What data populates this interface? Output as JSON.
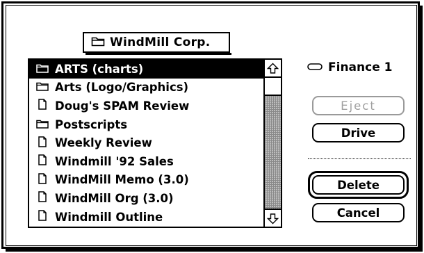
{
  "dialog": {
    "folder_popup": {
      "label": "WindMill Corp.",
      "icon": "folder-icon"
    },
    "file_list": {
      "items": [
        {
          "label": "ARTS (charts)",
          "icon": "folder-icon",
          "selected": true
        },
        {
          "label": "Arts (Logo/Graphics)",
          "icon": "folder-icon",
          "selected": false
        },
        {
          "label": "Doug's SPAM Review",
          "icon": "document-icon",
          "selected": false
        },
        {
          "label": "Postscripts",
          "icon": "folder-icon",
          "selected": false
        },
        {
          "label": "Weekly Review",
          "icon": "document-icon",
          "selected": false
        },
        {
          "label": "Windmill '92 Sales",
          "icon": "document-icon",
          "selected": false
        },
        {
          "label": "WindMill Memo (3.0)",
          "icon": "document-icon",
          "selected": false
        },
        {
          "label": "WindMill Org (3.0)",
          "icon": "document-icon",
          "selected": false
        },
        {
          "label": "Windmill Outline",
          "icon": "document-icon",
          "selected": false
        }
      ]
    },
    "disk": {
      "label": "Finance 1",
      "icon": "disk-icon"
    },
    "buttons": {
      "eject": "Eject",
      "drive": "Drive",
      "delete": "Delete",
      "cancel": "Cancel"
    }
  }
}
